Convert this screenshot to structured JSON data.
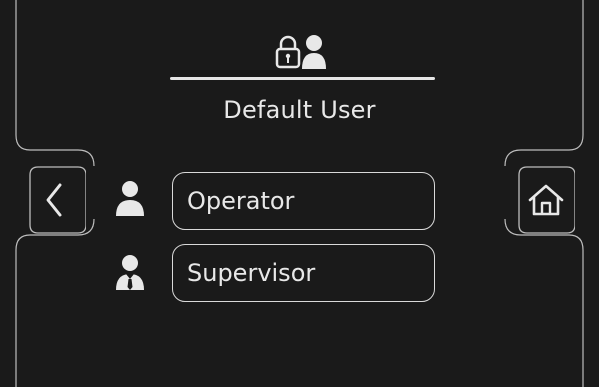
{
  "header": {
    "title": "Default User",
    "icon": "lock-user-icon"
  },
  "users": [
    {
      "label": "Operator",
      "icon": "operator-icon"
    },
    {
      "label": "Supervisor",
      "icon": "supervisor-icon"
    }
  ],
  "nav": {
    "back_icon": "chevron-left-icon",
    "home_icon": "home-icon"
  },
  "colors": {
    "background": "#1a1a1a",
    "foreground": "#e8e8e8"
  }
}
